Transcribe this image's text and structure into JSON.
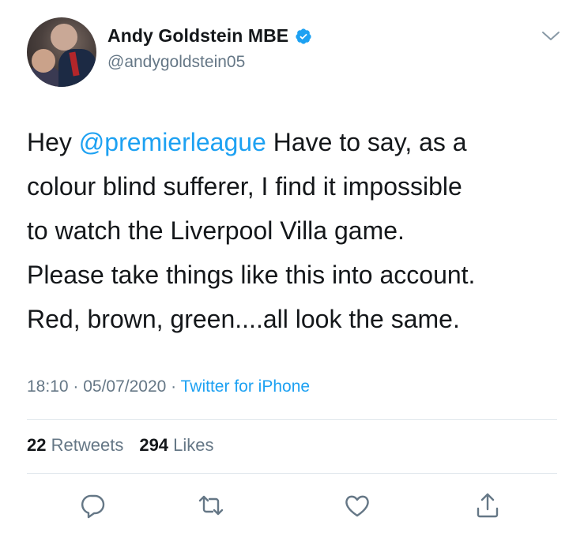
{
  "user": {
    "display_name": "Andy Goldstein MBE",
    "handle": "@andygoldstein05",
    "verified": true
  },
  "tweet": {
    "prefix": "Hey ",
    "mention": "@premierleague",
    "body": "  Have to say, as a\ncolour blind sufferer, I find it impossible\nto watch the Liverpool Villa game.\nPlease take things like this into account.\nRed, brown, green....all look the same."
  },
  "meta": {
    "time": "18:10",
    "separator1": " · ",
    "date": "05/07/2020",
    "separator2": " · ",
    "source": "Twitter for iPhone"
  },
  "stats": {
    "retweets_count": "22",
    "retweets_label": "Retweets",
    "likes_count": "294",
    "likes_label": "Likes"
  },
  "icons": {
    "reply": "reply-icon",
    "retweet": "retweet-icon",
    "like": "heart-icon",
    "share": "share-icon",
    "more": "chevron-down-icon",
    "verified": "verified-badge-icon"
  },
  "colors": {
    "accent": "#1da1f2",
    "text": "#14171a",
    "secondary": "#657786"
  }
}
